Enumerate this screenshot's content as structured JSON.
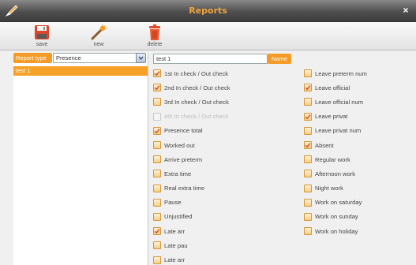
{
  "window": {
    "title": "Reports",
    "close_glyph": "×"
  },
  "toolbar": {
    "save_label": "save",
    "new_label": "new",
    "delete_label": "delete"
  },
  "report_type": {
    "label": "Report type",
    "value": "Presence"
  },
  "reports_list": [
    {
      "label": "test 1",
      "selected": true
    }
  ],
  "name_field": {
    "value": "test 1",
    "label": "Name"
  },
  "checkboxes_left": [
    {
      "label": "1st In check / Out check",
      "checked": true,
      "disabled": false
    },
    {
      "label": "2nd In check / Out check",
      "checked": true,
      "disabled": false
    },
    {
      "label": "3rd In check / Out check",
      "checked": false,
      "disabled": false
    },
    {
      "label": "4th In check / Out check",
      "checked": false,
      "disabled": true
    },
    {
      "label": "Presence total",
      "checked": true,
      "disabled": false
    },
    {
      "label": "Worked out",
      "checked": false,
      "disabled": false
    },
    {
      "label": "Arrive preterm",
      "checked": false,
      "disabled": false
    },
    {
      "label": "Extra time",
      "checked": false,
      "disabled": false
    },
    {
      "label": "Real extra time",
      "checked": false,
      "disabled": false
    },
    {
      "label": "Pause",
      "checked": false,
      "disabled": false
    },
    {
      "label": "Unjustified",
      "checked": false,
      "disabled": false
    },
    {
      "label": "Late arr",
      "checked": true,
      "disabled": false
    },
    {
      "label": "Late pau",
      "checked": false,
      "disabled": false
    },
    {
      "label": "Late arr",
      "checked": false,
      "disabled": false
    }
  ],
  "checkboxes_right": [
    {
      "label": "Leave preterm num",
      "checked": false,
      "disabled": false
    },
    {
      "label": "Leave official",
      "checked": true,
      "disabled": false
    },
    {
      "label": "Leave official num",
      "checked": false,
      "disabled": false
    },
    {
      "label": "Leave privat",
      "checked": true,
      "disabled": false
    },
    {
      "label": "Leave privat num",
      "checked": false,
      "disabled": false
    },
    {
      "label": "Absent",
      "checked": true,
      "disabled": false
    },
    {
      "label": "Regular work",
      "checked": false,
      "disabled": false
    },
    {
      "label": "Afternoon work",
      "checked": false,
      "disabled": false
    },
    {
      "label": "Night work",
      "checked": false,
      "disabled": false
    },
    {
      "label": "Work on saturday",
      "checked": false,
      "disabled": false
    },
    {
      "label": "Work on sunday",
      "checked": false,
      "disabled": false
    },
    {
      "label": "Work on holiday",
      "checked": false,
      "disabled": false
    }
  ],
  "colors": {
    "accent": "#f39b26",
    "title_text": "#f3a33a",
    "titlebar": "#4e4e4e",
    "checkbox_fill": "#f7cd85",
    "check_mark": "#d9462b"
  },
  "icons": {
    "app": "pencil-logo-icon",
    "save": "floppy-disk-icon",
    "new": "magic-wand-icon",
    "delete": "trash-can-icon",
    "close": "close-icon",
    "dropdown": "dropdown-icon",
    "check": "check-icon"
  }
}
